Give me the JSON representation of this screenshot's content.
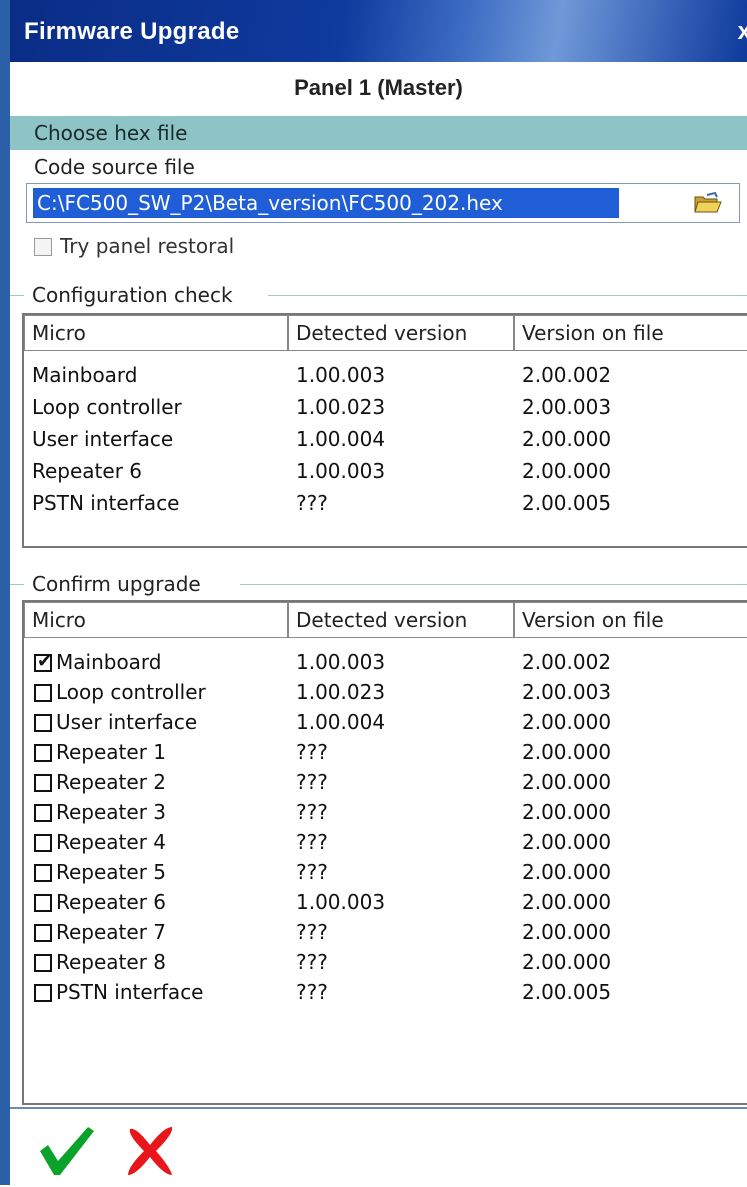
{
  "window": {
    "title": "Firmware Upgrade",
    "close_glyph": "x"
  },
  "panel": {
    "title": "Panel 1 (Master)"
  },
  "choose_hex": {
    "section_label": "Choose hex file",
    "source_label": "Code source file",
    "path_value": "C:\\FC500_SW_P2\\Beta_version\\FC500_202.hex",
    "browse_icon": "folder-open-icon",
    "restore_label": "Try panel restoral",
    "restore_checked": false
  },
  "config_check": {
    "title": "Configuration check",
    "columns": [
      "Micro",
      "Detected version",
      "Version on file"
    ],
    "rows": [
      {
        "micro": "Mainboard",
        "detected": "1.00.003",
        "file": "2.00.002"
      },
      {
        "micro": "Loop controller",
        "detected": "1.00.023",
        "file": "2.00.003"
      },
      {
        "micro": "User interface",
        "detected": "1.00.004",
        "file": "2.00.000"
      },
      {
        "micro": "Repeater 6",
        "detected": "1.00.003",
        "file": "2.00.000"
      },
      {
        "micro": "PSTN interface",
        "detected": "???",
        "file": "2.00.005"
      }
    ]
  },
  "confirm_upgrade": {
    "title": "Confirm upgrade",
    "columns": [
      "Micro",
      "Detected version",
      "Version on file"
    ],
    "rows": [
      {
        "micro": "Mainboard",
        "detected": "1.00.003",
        "file": "2.00.002",
        "checked": true
      },
      {
        "micro": "Loop controller",
        "detected": "1.00.023",
        "file": "2.00.003",
        "checked": false
      },
      {
        "micro": "User interface",
        "detected": "1.00.004",
        "file": "2.00.000",
        "checked": false
      },
      {
        "micro": "Repeater 1",
        "detected": "???",
        "file": "2.00.000",
        "checked": false
      },
      {
        "micro": "Repeater 2",
        "detected": "???",
        "file": "2.00.000",
        "checked": false
      },
      {
        "micro": "Repeater 3",
        "detected": "???",
        "file": "2.00.000",
        "checked": false
      },
      {
        "micro": "Repeater 4",
        "detected": "???",
        "file": "2.00.000",
        "checked": false
      },
      {
        "micro": "Repeater 5",
        "detected": "???",
        "file": "2.00.000",
        "checked": false
      },
      {
        "micro": "Repeater 6",
        "detected": "1.00.003",
        "file": "2.00.000",
        "checked": false
      },
      {
        "micro": "Repeater 7",
        "detected": "???",
        "file": "2.00.000",
        "checked": false
      },
      {
        "micro": "Repeater 8",
        "detected": "???",
        "file": "2.00.000",
        "checked": false
      },
      {
        "micro": "PSTN interface",
        "detected": "???",
        "file": "2.00.005",
        "checked": false
      }
    ]
  },
  "actions": {
    "ok_icon": "checkmark-icon",
    "cancel_icon": "cross-icon"
  },
  "colors": {
    "title_bar": "#0f3a9e",
    "section_bar": "#8fc4c6",
    "selection": "#1f5ed6",
    "ok": "#0aa329",
    "cancel": "#e8161b"
  }
}
